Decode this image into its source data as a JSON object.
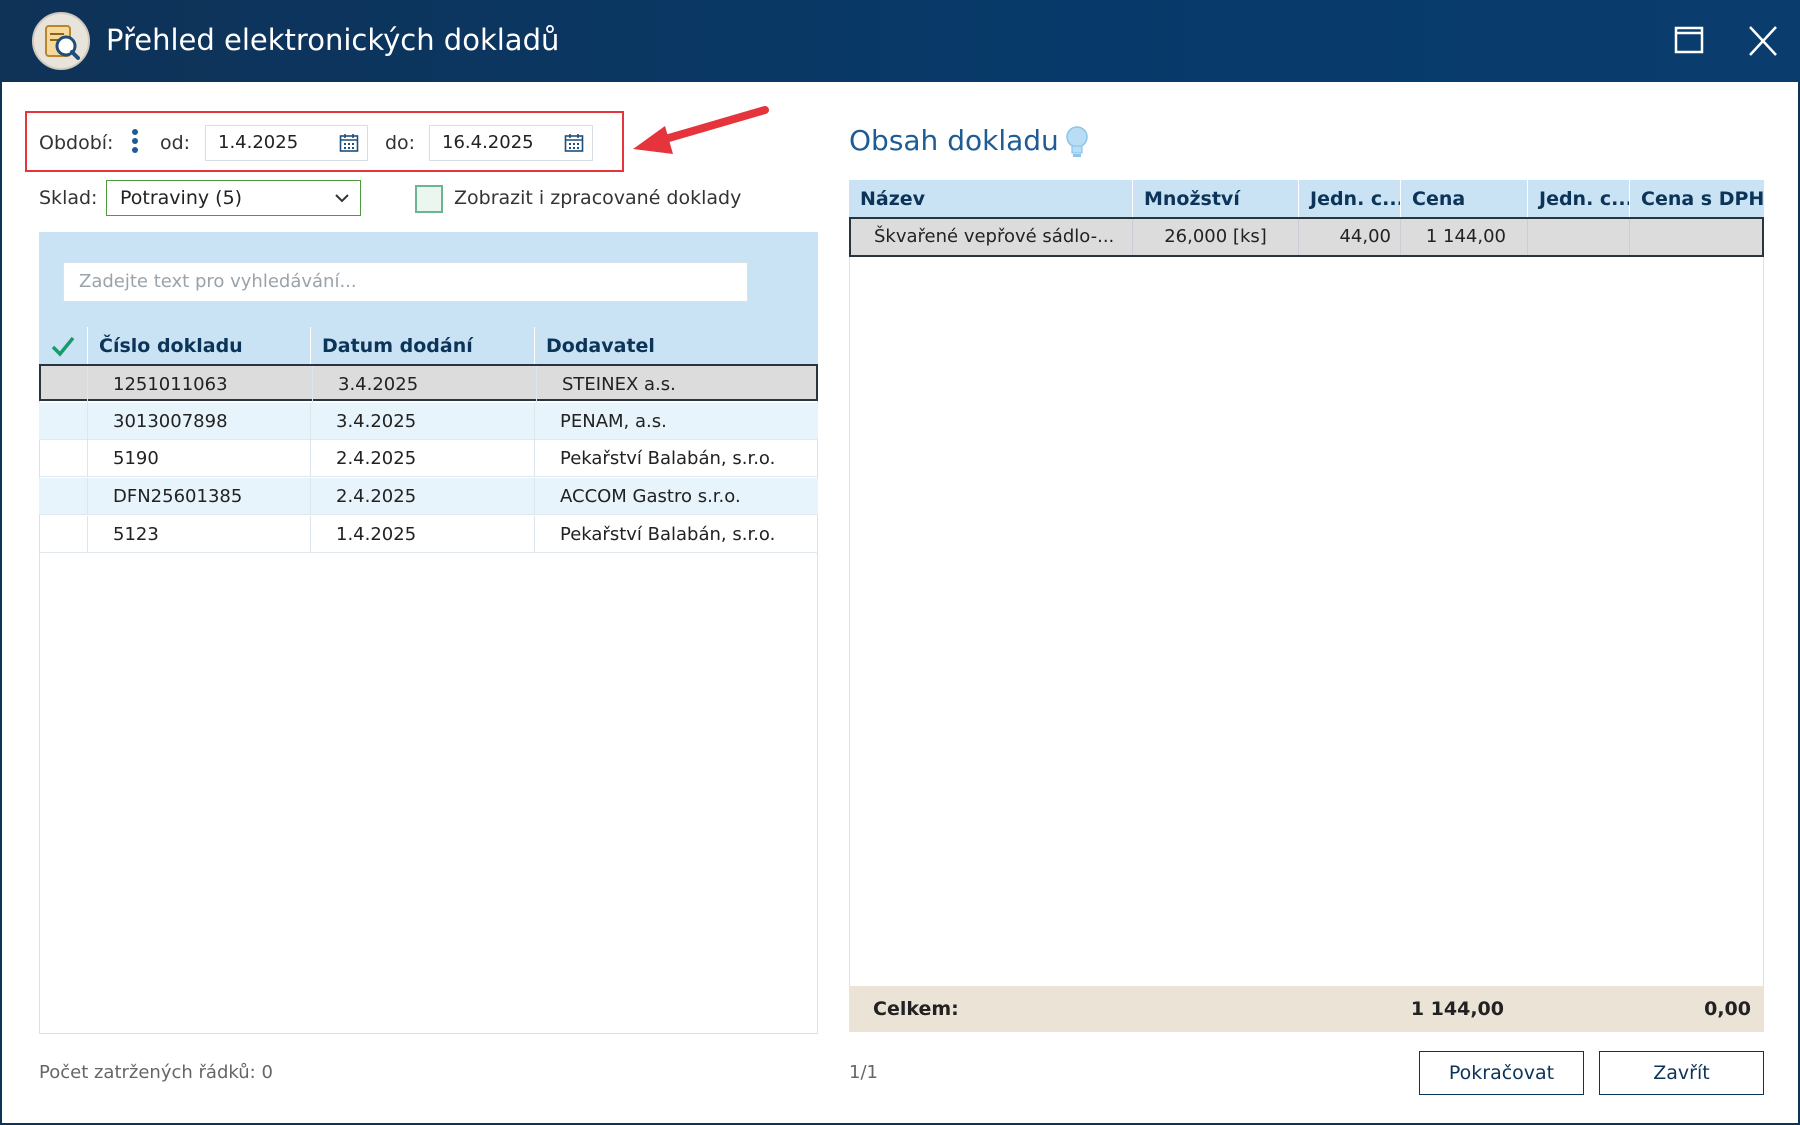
{
  "window": {
    "title": "Přehled elektronických dokladů"
  },
  "filter": {
    "period_label": "Období:",
    "from_label": "od:",
    "from_value": "1.4.2025",
    "to_label": "do:",
    "to_value": "16.4.2025",
    "store_label": "Sklad:",
    "store_value": "Potraviny (5)",
    "show_processed_label": "Zobrazit i zpracované doklady",
    "show_processed_checked": false
  },
  "search": {
    "placeholder": "Zadejte text pro vyhledávání..."
  },
  "documents": {
    "columns": [
      "Číslo dokladu",
      "Datum dodání",
      "Dodavatel"
    ],
    "rows": [
      {
        "number": "1251011063",
        "date": "3.4.2025",
        "supplier": "STEINEX a.s.",
        "selected": true
      },
      {
        "number": "3013007898",
        "date": "3.4.2025",
        "supplier": "PENAM, a.s."
      },
      {
        "number": "5190",
        "date": "2.4.2025",
        "supplier": "Pekařství Balabán, s.r.o."
      },
      {
        "number": "DFN25601385",
        "date": "2.4.2025",
        "supplier": "ACCOM Gastro s.r.o."
      },
      {
        "number": "5123",
        "date": "1.4.2025",
        "supplier": "Pekařství Balabán, s.r.o."
      }
    ]
  },
  "content": {
    "title": "Obsah dokladu",
    "columns": [
      "Název",
      "Množství",
      "Jedn. c...",
      "Cena",
      "Jedn. c...",
      "Cena s DPH"
    ],
    "rows": [
      {
        "name": "Škvařené vepřové sádlo-...",
        "qty": "26,000 [ks]",
        "unit_price": "44,00",
        "price": "1 144,00",
        "unit_price_vat": "",
        "price_vat": ""
      }
    ],
    "totals": {
      "label": "Celkem:",
      "price": "1 144,00",
      "price_vat": "0,00"
    },
    "page": "1/1"
  },
  "footer": {
    "checked_rows": "Počet zatržených řádků: 0",
    "continue_label": "Pokračovat",
    "close_label": "Zavřít"
  },
  "colors": {
    "titlebar": "#0f3257",
    "header_bg": "#c9e3f4",
    "accent": "#1f5c95",
    "annotation": "#e5343b",
    "totals_bg": "#ece3d7"
  }
}
